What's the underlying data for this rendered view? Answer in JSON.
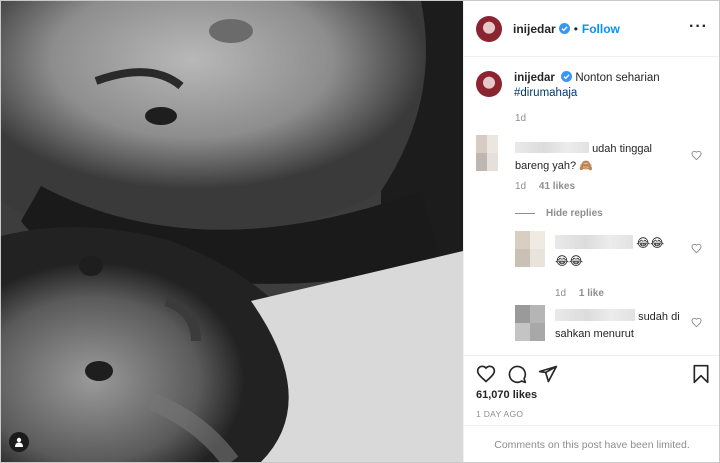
{
  "post": {
    "username": "inijedar",
    "verified": true,
    "follow_label": "Follow",
    "more_icon": "more-dots-icon"
  },
  "caption": {
    "text": "Nonton seharian",
    "hashtag": "#dirumahaja",
    "time": "1d"
  },
  "comments": [
    {
      "text_line1": "udah tinggal",
      "text_line2": "bareng yah? 🙈",
      "time": "1d",
      "likes": "41 likes",
      "username_hidden": true
    }
  ],
  "replies_toggle": "Hide replies",
  "replies": [
    {
      "text": "😂😂",
      "text_line2": "😂😂",
      "time": "1d",
      "likes": "1 like",
      "username_hidden": true
    },
    {
      "text": "sudah di",
      "text_line2": "sahkan menurut",
      "username_hidden": true
    }
  ],
  "actions": {
    "like_icon": "heart-outline-icon",
    "comment_icon": "comment-bubble-icon",
    "share_icon": "share-plane-icon",
    "save_icon": "bookmark-icon"
  },
  "likes_count": "61,070 likes",
  "posted_ago": "1 DAY AGO",
  "comments_notice": "Comments on this post have been limited.",
  "colors": {
    "link_blue": "#0095f6",
    "hashtag": "#00376b",
    "muted": "#8e8e8e",
    "text": "#262626",
    "border": "#efefef"
  }
}
